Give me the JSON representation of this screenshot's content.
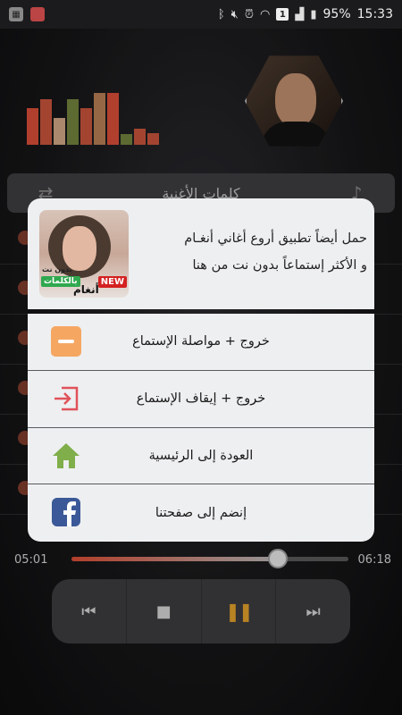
{
  "status_bar": {
    "battery": "95%",
    "time": "15:33",
    "notification_badge": "1"
  },
  "player": {
    "tab_title": "كلمات الأغنية",
    "elapsed": "05:01",
    "duration": "06:18",
    "progress": 0.745,
    "equalizer_bar_colors": [
      "#d04a35",
      "#c0503a",
      "#c8a080",
      "#6e7d3a",
      "#c0503a",
      "#b07a50",
      "#d04a35",
      "#6e7d3a",
      "#c0503a",
      "#c0503a"
    ],
    "equalizer_levels": [
      0.62,
      0.78,
      0.45,
      0.78,
      0.62,
      0.88,
      0.88,
      0.18,
      0.28,
      0.2
    ]
  },
  "dialog": {
    "promo": {
      "text_line1": "حمل أيضاً تطبيق أروع أغاني أنغـام",
      "text_line2": "و الأكثر إستماعاً بدون نت من هنا",
      "thumb_small_label": "بدون نت",
      "thumb_green_label": "بالكلمات",
      "thumb_new_label": "NEW",
      "thumb_name": "أنغام"
    },
    "menu": [
      {
        "label": "خروج + مواصلة الإستماع",
        "icon": "minus-icon"
      },
      {
        "label": "خروج + إيقاف الإستماع",
        "icon": "exit-icon"
      },
      {
        "label": "العودة إلى الرئيسية",
        "icon": "home-icon"
      },
      {
        "label": "إنضم إلى صفحتنا",
        "icon": "facebook-icon"
      }
    ]
  },
  "colors": {
    "accent": "#d24a33",
    "pause": "#d99a2a",
    "minus_icon": "#f5a762",
    "exit_icon": "#e0525a",
    "home_icon": "#7fae4a",
    "facebook": "#3b5998"
  }
}
